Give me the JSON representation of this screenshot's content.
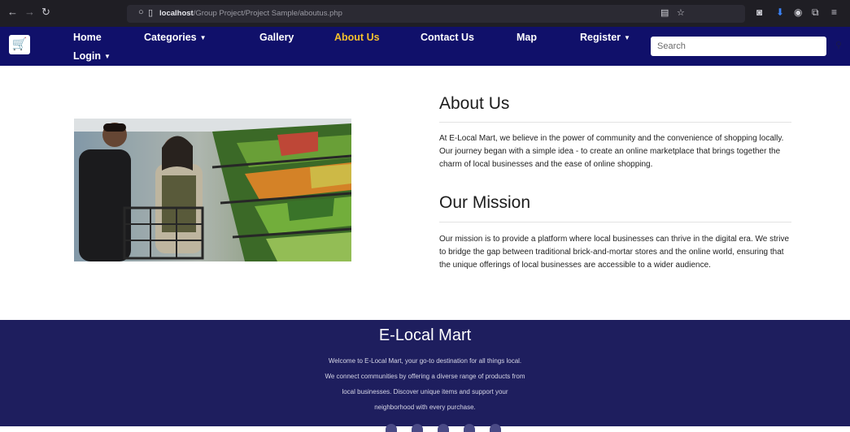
{
  "browser": {
    "url_host": "localhost",
    "url_path": "/Group Project/Project Sample/aboutus.php"
  },
  "nav": {
    "home": "Home",
    "categories": "Categories",
    "gallery": "Gallery",
    "about": "About Us",
    "contact": "Contact Us",
    "map": "Map",
    "register": "Register",
    "login": "Login",
    "search_placeholder": "Search"
  },
  "about": {
    "heading": "About Us",
    "body": "At E-Local Mart, we believe in the power of community and the convenience of shopping locally. Our journey began with a simple idea - to create an online marketplace that brings together the charm of local businesses and the ease of online shopping."
  },
  "mission": {
    "heading": "Our Mission",
    "body": "Our mission is to provide a platform where local businesses can thrive in the digital era. We strive to bridge the gap between traditional brick-and-mortar stores and the online world, ensuring that the unique offerings of local businesses are accessible to a wider audience."
  },
  "footer": {
    "title": "E-Local Mart",
    "line1": "Welcome to E-Local Mart, your go-to destination for all things local.",
    "line2": "We connect communities by offering a diverse range of products from",
    "line3": "local businesses. Discover unique items and support your",
    "line4": "neighborhood with every purchase."
  },
  "colors": {
    "navbar": "#10106a",
    "active": "#f5c02c",
    "footer": "#1e1e5e"
  },
  "icons": [
    "back-arrow-icon",
    "forward-arrow-icon",
    "reload-icon",
    "page-info-icon",
    "reader-view-icon",
    "bookmark-star-icon",
    "pocket-icon",
    "account-icon",
    "extensions-icon",
    "menu-icon",
    "cart-logo-icon",
    "caret-down-icon",
    "search-icon"
  ]
}
